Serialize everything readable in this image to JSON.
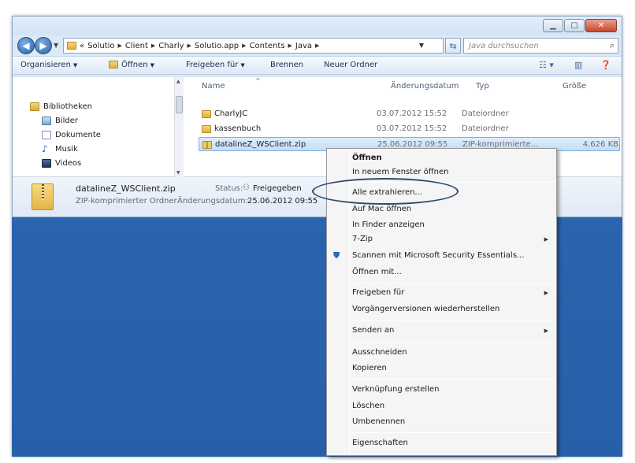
{
  "address": {
    "prefix": "«",
    "crumbs": [
      "Solutio",
      "Client",
      "Charly",
      "Solutio.app",
      "Contents",
      "Java"
    ],
    "search_placeholder": "Java durchsuchen"
  },
  "toolbar": {
    "organize": "Organisieren",
    "open": "Öffnen",
    "share": "Freigeben für",
    "burn": "Brennen",
    "new_folder": "Neuer Ordner"
  },
  "nav": {
    "libraries": "Bibliotheken",
    "items": [
      "Bilder",
      "Dokumente",
      "Musik",
      "Videos"
    ]
  },
  "columns": {
    "name": "Name",
    "date": "Änderungsdatum",
    "type": "Typ",
    "size": "Größe"
  },
  "files": [
    {
      "name": "CharlyJC",
      "date": "03.07.2012 15:52",
      "type": "Dateiordner",
      "size": ""
    },
    {
      "name": "kassenbuch",
      "date": "03.07.2012 15:52",
      "type": "Dateiordner",
      "size": ""
    },
    {
      "name": "datalineZ_WSClient.zip",
      "date": "25.06.2012 09:55",
      "type": "ZIP-komprimierte...",
      "size": "4.626 KB"
    }
  ],
  "details": {
    "name": "datalineZ_WSClient.zip",
    "type": "ZIP-komprimierter Ordner",
    "status_label": "Status:",
    "status_value": "Freigegeben",
    "date_label": "Änderungsdatum:",
    "date_value": "25.06.2012 09:55"
  },
  "context_menu": {
    "open": "Öffnen",
    "open_new": "In neuem Fenster öffnen",
    "extract": "Alle extrahieren...",
    "open_mac": "Auf Mac öffnen",
    "show_finder": "In Finder anzeigen",
    "zip": "7-Zip",
    "scan": "Scannen mit Microsoft Security Essentials...",
    "open_with": "Öffnen mit...",
    "share": "Freigeben für",
    "restore": "Vorgängerversionen wiederherstellen",
    "send_to": "Senden an",
    "cut": "Ausschneiden",
    "copy": "Kopieren",
    "shortcut": "Verknüpfung erstellen",
    "delete": "Löschen",
    "rename": "Umbenennen",
    "properties": "Eigenschaften"
  }
}
